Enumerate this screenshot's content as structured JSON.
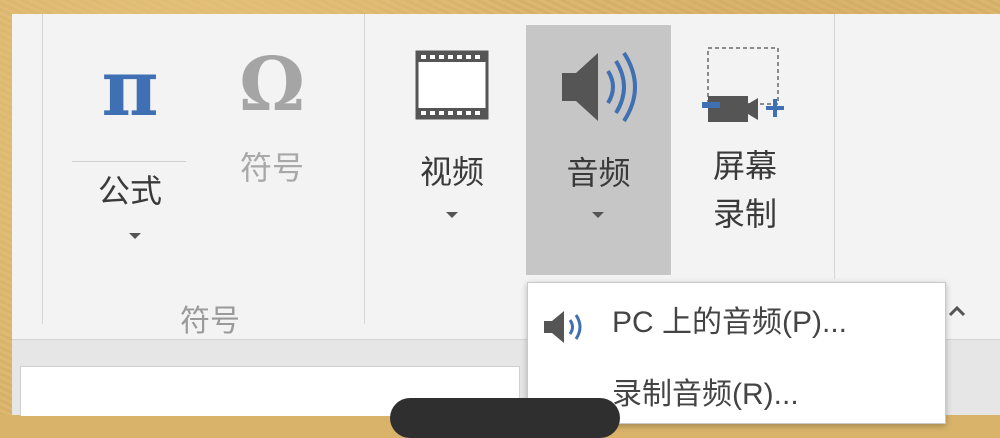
{
  "ribbon": {
    "formula": {
      "label": "公式",
      "icon": "pi-icon"
    },
    "symbol": {
      "label": "符号",
      "icon": "omega-icon"
    },
    "group_symbol_label": "符号",
    "video": {
      "label": "视频",
      "icon": "film-icon"
    },
    "audio": {
      "label": "音频",
      "icon": "speaker-icon",
      "state": "pressed"
    },
    "screen_record": {
      "label_line1": "屏幕",
      "label_line2": "录制",
      "icon": "screen-record-icon"
    }
  },
  "audio_menu": {
    "items": [
      {
        "label": "PC 上的音频(P)...",
        "icon": "speaker-icon"
      },
      {
        "label": "录制音频(R)...",
        "icon": ""
      }
    ]
  },
  "colors": {
    "accent_blue": "#3f70b3",
    "ribbon_bg": "#f3f3f3",
    "pressed_bg": "#c6c6c6"
  }
}
